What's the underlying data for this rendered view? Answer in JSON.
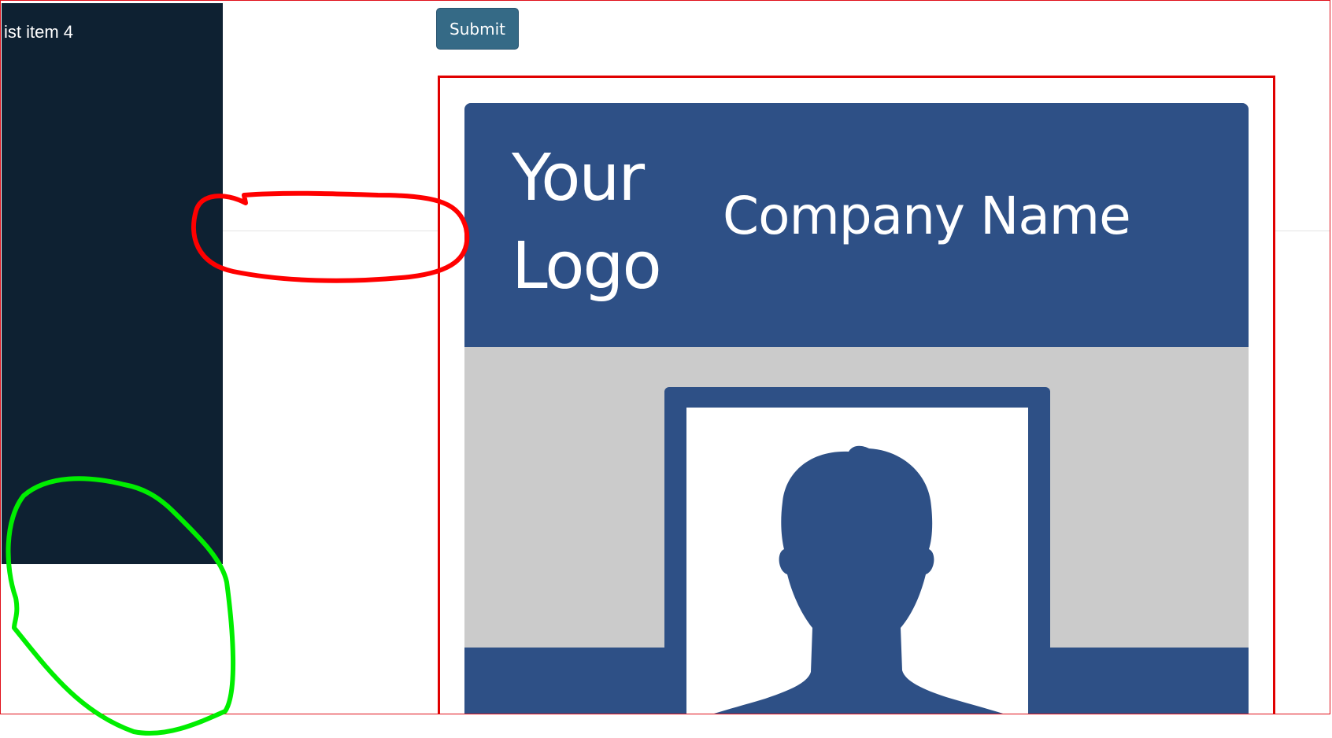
{
  "sidebar": {
    "items": [
      {
        "label": "ist item 4"
      }
    ]
  },
  "toolbar": {
    "submit_label": "Submit"
  },
  "id_card": {
    "logo_line1": "Your",
    "logo_line2": "Logo",
    "company_name": "Company Name",
    "avatar_icon": "person-silhouette-icon"
  },
  "annotations": {
    "red_circle_color": "#ff0000",
    "green_circle_color": "#00ee00"
  },
  "colors": {
    "sidebar_bg": "#0e2132",
    "card_blue": "#2e5086",
    "card_gray": "#cbcbcb",
    "button_bg": "#356a86",
    "box_border": "#e00000"
  }
}
